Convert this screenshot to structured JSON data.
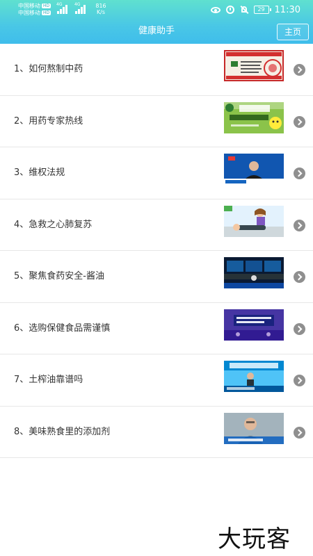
{
  "status_bar": {
    "carrier1": "中国移动",
    "carrier2": "中国移动",
    "hd_badge": "HD",
    "network1": "4G",
    "network2": "4G",
    "speed_value": "816",
    "speed_unit": "K/s",
    "battery": "29",
    "time": "11:30"
  },
  "header": {
    "title": "健康助手",
    "home_button": "主页"
  },
  "items": [
    {
      "label": "1、如何熬制中药",
      "thumb": "red-certificate-thumbnail"
    },
    {
      "label": "2、用药专家热线",
      "thumb": "green-hotline-thumbnail"
    },
    {
      "label": "3、维权法规",
      "thumb": "news-anchor-thumbnail"
    },
    {
      "label": "4、急救之心肺复苏",
      "thumb": "cpr-cartoon-thumbnail"
    },
    {
      "label": "5、聚焦食药安全-酱油",
      "thumb": "dark-studio-thumbnail"
    },
    {
      "label": "6、选购保健食品需谨慎",
      "thumb": "purple-studio-thumbnail"
    },
    {
      "label": "7、土榨油靠谱吗",
      "thumb": "blue-show-thumbnail"
    },
    {
      "label": "8、美味熟食里的添加剂",
      "thumb": "interview-thumbnail"
    }
  ],
  "watermark": "大玩客"
}
